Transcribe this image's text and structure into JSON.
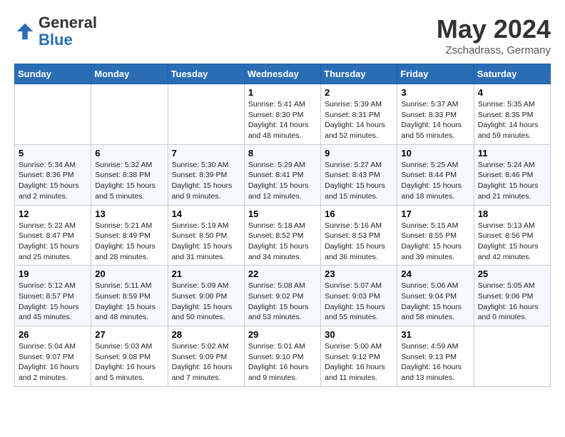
{
  "header": {
    "logo_text_general": "General",
    "logo_text_blue": "Blue",
    "month_year": "May 2024",
    "location": "Zschadrass, Germany"
  },
  "days_of_week": [
    "Sunday",
    "Monday",
    "Tuesday",
    "Wednesday",
    "Thursday",
    "Friday",
    "Saturday"
  ],
  "weeks": [
    [
      {
        "num": "",
        "info": ""
      },
      {
        "num": "",
        "info": ""
      },
      {
        "num": "",
        "info": ""
      },
      {
        "num": "1",
        "info": "Sunrise: 5:41 AM\nSunset: 8:30 PM\nDaylight: 14 hours and 48 minutes."
      },
      {
        "num": "2",
        "info": "Sunrise: 5:39 AM\nSunset: 8:31 PM\nDaylight: 14 hours and 52 minutes."
      },
      {
        "num": "3",
        "info": "Sunrise: 5:37 AM\nSunset: 8:33 PM\nDaylight: 14 hours and 55 minutes."
      },
      {
        "num": "4",
        "info": "Sunrise: 5:35 AM\nSunset: 8:35 PM\nDaylight: 14 hours and 59 minutes."
      }
    ],
    [
      {
        "num": "5",
        "info": "Sunrise: 5:34 AM\nSunset: 8:36 PM\nDaylight: 15 hours and 2 minutes."
      },
      {
        "num": "6",
        "info": "Sunrise: 5:32 AM\nSunset: 8:38 PM\nDaylight: 15 hours and 5 minutes."
      },
      {
        "num": "7",
        "info": "Sunrise: 5:30 AM\nSunset: 8:39 PM\nDaylight: 15 hours and 9 minutes."
      },
      {
        "num": "8",
        "info": "Sunrise: 5:29 AM\nSunset: 8:41 PM\nDaylight: 15 hours and 12 minutes."
      },
      {
        "num": "9",
        "info": "Sunrise: 5:27 AM\nSunset: 8:43 PM\nDaylight: 15 hours and 15 minutes."
      },
      {
        "num": "10",
        "info": "Sunrise: 5:25 AM\nSunset: 8:44 PM\nDaylight: 15 hours and 18 minutes."
      },
      {
        "num": "11",
        "info": "Sunrise: 5:24 AM\nSunset: 8:46 PM\nDaylight: 15 hours and 21 minutes."
      }
    ],
    [
      {
        "num": "12",
        "info": "Sunrise: 5:22 AM\nSunset: 8:47 PM\nDaylight: 15 hours and 25 minutes."
      },
      {
        "num": "13",
        "info": "Sunrise: 5:21 AM\nSunset: 8:49 PM\nDaylight: 15 hours and 28 minutes."
      },
      {
        "num": "14",
        "info": "Sunrise: 5:19 AM\nSunset: 8:50 PM\nDaylight: 15 hours and 31 minutes."
      },
      {
        "num": "15",
        "info": "Sunrise: 5:18 AM\nSunset: 8:52 PM\nDaylight: 15 hours and 34 minutes."
      },
      {
        "num": "16",
        "info": "Sunrise: 5:16 AM\nSunset: 8:53 PM\nDaylight: 15 hours and 36 minutes."
      },
      {
        "num": "17",
        "info": "Sunrise: 5:15 AM\nSunset: 8:55 PM\nDaylight: 15 hours and 39 minutes."
      },
      {
        "num": "18",
        "info": "Sunrise: 5:13 AM\nSunset: 8:56 PM\nDaylight: 15 hours and 42 minutes."
      }
    ],
    [
      {
        "num": "19",
        "info": "Sunrise: 5:12 AM\nSunset: 8:57 PM\nDaylight: 15 hours and 45 minutes."
      },
      {
        "num": "20",
        "info": "Sunrise: 5:11 AM\nSunset: 8:59 PM\nDaylight: 15 hours and 48 minutes."
      },
      {
        "num": "21",
        "info": "Sunrise: 5:09 AM\nSunset: 9:00 PM\nDaylight: 15 hours and 50 minutes."
      },
      {
        "num": "22",
        "info": "Sunrise: 5:08 AM\nSunset: 9:02 PM\nDaylight: 15 hours and 53 minutes."
      },
      {
        "num": "23",
        "info": "Sunrise: 5:07 AM\nSunset: 9:03 PM\nDaylight: 15 hours and 55 minutes."
      },
      {
        "num": "24",
        "info": "Sunrise: 5:06 AM\nSunset: 9:04 PM\nDaylight: 15 hours and 58 minutes."
      },
      {
        "num": "25",
        "info": "Sunrise: 5:05 AM\nSunset: 9:06 PM\nDaylight: 16 hours and 0 minutes."
      }
    ],
    [
      {
        "num": "26",
        "info": "Sunrise: 5:04 AM\nSunset: 9:07 PM\nDaylight: 16 hours and 2 minutes."
      },
      {
        "num": "27",
        "info": "Sunrise: 5:03 AM\nSunset: 9:08 PM\nDaylight: 16 hours and 5 minutes."
      },
      {
        "num": "28",
        "info": "Sunrise: 5:02 AM\nSunset: 9:09 PM\nDaylight: 16 hours and 7 minutes."
      },
      {
        "num": "29",
        "info": "Sunrise: 5:01 AM\nSunset: 9:10 PM\nDaylight: 16 hours and 9 minutes."
      },
      {
        "num": "30",
        "info": "Sunrise: 5:00 AM\nSunset: 9:12 PM\nDaylight: 16 hours and 11 minutes."
      },
      {
        "num": "31",
        "info": "Sunrise: 4:59 AM\nSunset: 9:13 PM\nDaylight: 16 hours and 13 minutes."
      },
      {
        "num": "",
        "info": ""
      }
    ]
  ]
}
